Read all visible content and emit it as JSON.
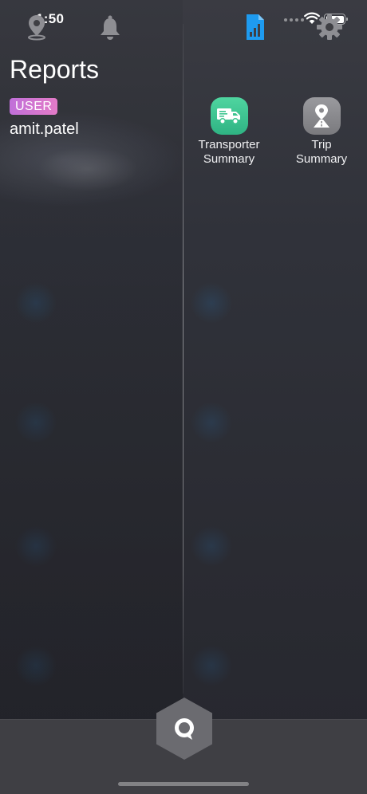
{
  "status_bar": {
    "time": "1:50"
  },
  "header": {
    "title": "Reports",
    "role_badge": "USER",
    "username": "amit.patel"
  },
  "reports": [
    {
      "label_line1": "Transporter",
      "label_line2": "Summary",
      "icon": "truck-icon",
      "color": "#3cc48f"
    },
    {
      "label_line1": "Trip",
      "label_line2": "Summary",
      "icon": "route-pin-icon",
      "color": "#8a8a8e"
    }
  ],
  "tab_bar": {
    "items": [
      {
        "name": "map",
        "icon": "location-pin-icon",
        "active": false
      },
      {
        "name": "alerts",
        "icon": "bell-icon",
        "active": false
      },
      {
        "name": "chat",
        "icon": "chat-bubble-icon",
        "active": false
      },
      {
        "name": "reports",
        "icon": "report-chart-icon",
        "active": true
      },
      {
        "name": "settings",
        "icon": "gear-icon",
        "active": false
      }
    ],
    "active_color": "#1e9bf0",
    "inactive_color": "#8e8e93"
  }
}
